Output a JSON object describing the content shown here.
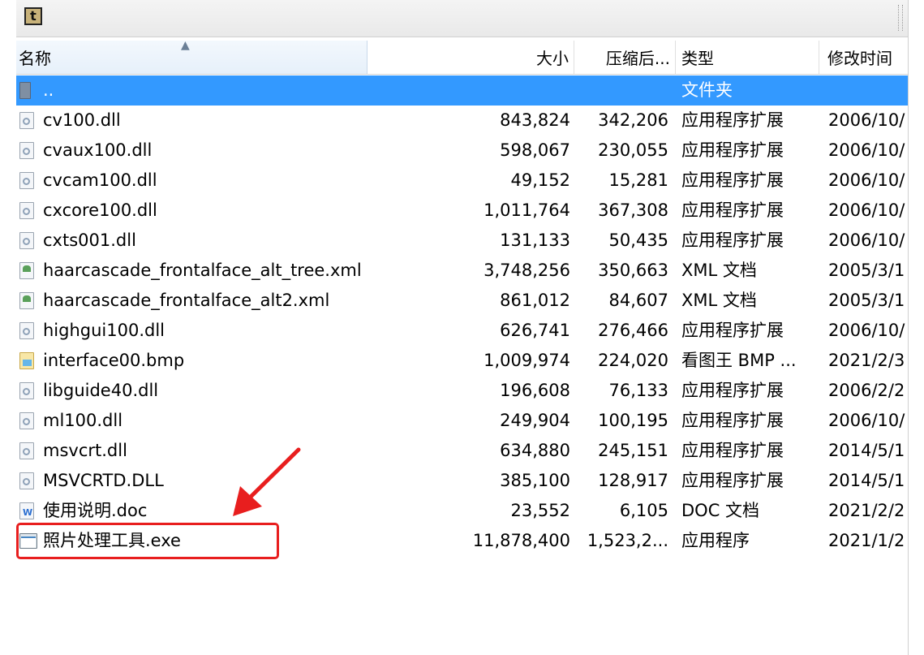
{
  "toolbar": {
    "up_icon_text": "t"
  },
  "columns": {
    "name": "名称",
    "size": "大小",
    "compressed": "压缩后...",
    "type": "类型",
    "modified": "修改时间"
  },
  "rows": [
    {
      "icon": "folder-icon",
      "name": "..",
      "size": "",
      "compressed": "",
      "type": "文件夹",
      "modified": "",
      "selected": true
    },
    {
      "icon": "dll-file-icon",
      "name": "cv100.dll",
      "size": "843,824",
      "compressed": "342,206",
      "type": "应用程序扩展",
      "modified": "2006/10/"
    },
    {
      "icon": "dll-file-icon",
      "name": "cvaux100.dll",
      "size": "598,067",
      "compressed": "230,055",
      "type": "应用程序扩展",
      "modified": "2006/10/"
    },
    {
      "icon": "dll-file-icon",
      "name": "cvcam100.dll",
      "size": "49,152",
      "compressed": "15,281",
      "type": "应用程序扩展",
      "modified": "2006/10/"
    },
    {
      "icon": "dll-file-icon",
      "name": "cxcore100.dll",
      "size": "1,011,764",
      "compressed": "367,308",
      "type": "应用程序扩展",
      "modified": "2006/10/"
    },
    {
      "icon": "dll-file-icon",
      "name": "cxts001.dll",
      "size": "131,133",
      "compressed": "50,435",
      "type": "应用程序扩展",
      "modified": "2006/10/"
    },
    {
      "icon": "xml-file-icon",
      "name": "haarcascade_frontalface_alt_tree.xml",
      "size": "3,748,256",
      "compressed": "350,663",
      "type": "XML 文档",
      "modified": "2005/3/1"
    },
    {
      "icon": "xml-file-icon",
      "name": "haarcascade_frontalface_alt2.xml",
      "size": "861,012",
      "compressed": "84,607",
      "type": "XML 文档",
      "modified": "2005/3/1"
    },
    {
      "icon": "dll-file-icon",
      "name": "highgui100.dll",
      "size": "626,741",
      "compressed": "276,466",
      "type": "应用程序扩展",
      "modified": "2006/10/"
    },
    {
      "icon": "bmp-file-icon",
      "name": "interface00.bmp",
      "size": "1,009,974",
      "compressed": "224,020",
      "type": "看图王 BMP ...",
      "modified": "2021/2/3"
    },
    {
      "icon": "dll-file-icon",
      "name": "libguide40.dll",
      "size": "196,608",
      "compressed": "76,133",
      "type": "应用程序扩展",
      "modified": "2006/2/2"
    },
    {
      "icon": "dll-file-icon",
      "name": "ml100.dll",
      "size": "249,904",
      "compressed": "100,195",
      "type": "应用程序扩展",
      "modified": "2006/10/"
    },
    {
      "icon": "dll-file-icon",
      "name": "msvcrt.dll",
      "size": "634,880",
      "compressed": "245,151",
      "type": "应用程序扩展",
      "modified": "2014/5/1"
    },
    {
      "icon": "dll-file-icon",
      "name": "MSVCRTD.DLL",
      "size": "385,100",
      "compressed": "128,917",
      "type": "应用程序扩展",
      "modified": "2014/5/1"
    },
    {
      "icon": "doc-file-icon",
      "name": "使用说明.doc",
      "size": "23,552",
      "compressed": "6,105",
      "type": "DOC 文档",
      "modified": "2021/2/2"
    },
    {
      "icon": "exe-file-icon",
      "name": "照片处理工具.exe",
      "size": "11,878,400",
      "compressed": "1,523,2...",
      "type": "应用程序",
      "modified": "2021/1/2"
    }
  ],
  "annotation": {
    "color": "#e81e1e",
    "highlighted_file": "照片处理工具.exe"
  }
}
